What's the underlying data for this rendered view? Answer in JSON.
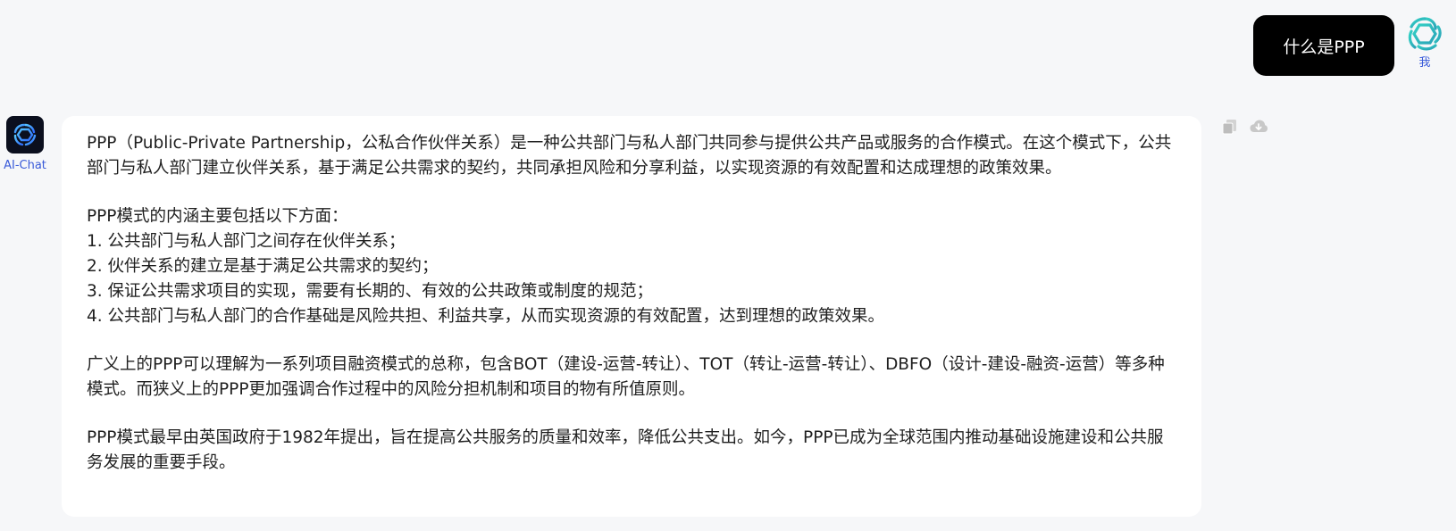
{
  "user_message": {
    "text": "什么是PPP",
    "sender_label": "我"
  },
  "bot_message": {
    "sender_label": "AI-Chat",
    "paragraphs": {
      "p1": "PPP（Public-Private Partnership，公私合作伙伴关系）是一种公共部门与私人部门共同参与提供公共产品或服务的合作模式。在这个模式下，公共部门与私人部门建立伙伴关系，基于满足公共需求的契约，共同承担风险和分享利益，以实现资源的有效配置和达成理想的政策效果。",
      "p2_intro": "PPP模式的内涵主要包括以下方面：",
      "p2_item1": "1. 公共部门与私人部门之间存在伙伴关系；",
      "p2_item2": "2. 伙伴关系的建立是基于满足公共需求的契约；",
      "p2_item3": "3. 保证公共需求项目的实现，需要有长期的、有效的公共政策或制度的规范；",
      "p2_item4": "4. 公共部门与私人部门的合作基础是风险共担、利益共享，从而实现资源的有效配置，达到理想的政策效果。",
      "p3": "广义上的PPP可以理解为一系列项目融资模式的总称，包含BOT（建设-运营-转让）、TOT（转让-运营-转让）、DBFO（设计-建设-融资-运营）等多种模式。而狭义上的PPP更加强调合作过程中的风险分担机制和项目的物有所值原则。",
      "p4": "PPP模式最早由英国政府于1982年提出，旨在提高公共服务的质量和效率，降低公共支出。如今，PPP已成为全球范围内推动基础设施建设和公共服务发展的重要手段。"
    }
  },
  "actions": {
    "copy_icon": "copy-icon",
    "download_icon": "cloud-download-icon"
  },
  "colors": {
    "background": "#f6f7f9",
    "user_bubble": "#000000",
    "bot_bubble": "#ffffff",
    "name_label": "#3a5bd9",
    "action_icon": "#c8c8c8"
  }
}
